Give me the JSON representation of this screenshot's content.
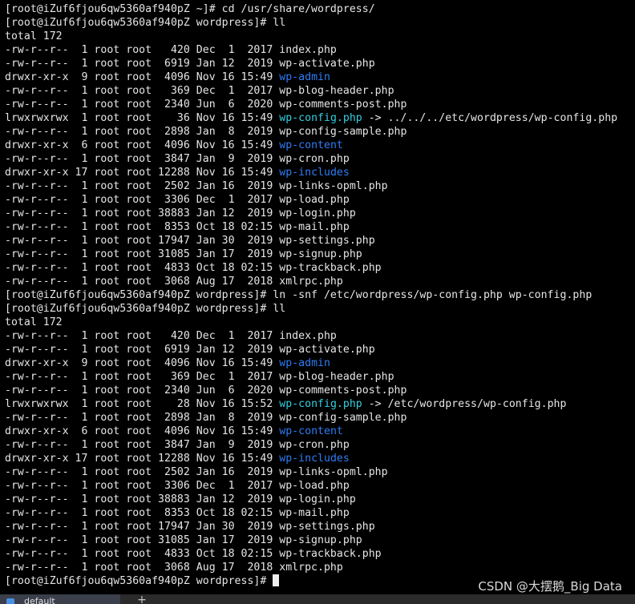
{
  "terminal": {
    "colors": {
      "text": "#e6e6e6",
      "directory": "#2f7df6",
      "symlink": "#33d0e0",
      "background": "#000000"
    },
    "lines": [
      [
        {
          "text": "[root@iZuf6fjou6qw5360af940pZ ~]# cd /usr/share/wordpress/"
        }
      ],
      [
        {
          "text": "[root@iZuf6fjou6qw5360af940pZ wordpress]# ll"
        }
      ],
      [
        {
          "text": "total 172"
        }
      ],
      [
        {
          "text": "-rw-r--r--  1 root root   420 Dec  1  2017 index.php"
        }
      ],
      [
        {
          "text": "-rw-r--r--  1 root root  6919 Jan 12  2019 wp-activate.php"
        }
      ],
      [
        {
          "text": "drwxr-xr-x  9 root root  4096 Nov 16 15:49 "
        },
        {
          "text": "wp-admin",
          "kind": "dir"
        }
      ],
      [
        {
          "text": "-rw-r--r--  1 root root   369 Dec  1  2017 wp-blog-header.php"
        }
      ],
      [
        {
          "text": "-rw-r--r--  1 root root  2340 Jun  6  2020 wp-comments-post.php"
        }
      ],
      [
        {
          "text": "lrwxrwxrwx  1 root root    36 Nov 16 15:49 "
        },
        {
          "text": "wp-config.php",
          "kind": "link"
        },
        {
          "text": " -> ../../../etc/wordpress/wp-config.php"
        }
      ],
      [
        {
          "text": "-rw-r--r--  1 root root  2898 Jan  8  2019 wp-config-sample.php"
        }
      ],
      [
        {
          "text": "drwxr-xr-x  6 root root  4096 Nov 16 15:49 "
        },
        {
          "text": "wp-content",
          "kind": "dir"
        }
      ],
      [
        {
          "text": "-rw-r--r--  1 root root  3847 Jan  9  2019 wp-cron.php"
        }
      ],
      [
        {
          "text": "drwxr-xr-x 17 root root 12288 Nov 16 15:49 "
        },
        {
          "text": "wp-includes",
          "kind": "dir"
        }
      ],
      [
        {
          "text": "-rw-r--r--  1 root root  2502 Jan 16  2019 wp-links-opml.php"
        }
      ],
      [
        {
          "text": "-rw-r--r--  1 root root  3306 Dec  1  2017 wp-load.php"
        }
      ],
      [
        {
          "text": "-rw-r--r--  1 root root 38883 Jan 12  2019 wp-login.php"
        }
      ],
      [
        {
          "text": "-rw-r--r--  1 root root  8353 Oct 18 02:15 wp-mail.php"
        }
      ],
      [
        {
          "text": "-rw-r--r--  1 root root 17947 Jan 30  2019 wp-settings.php"
        }
      ],
      [
        {
          "text": "-rw-r--r--  1 root root 31085 Jan 17  2019 wp-signup.php"
        }
      ],
      [
        {
          "text": "-rw-r--r--  1 root root  4833 Oct 18 02:15 wp-trackback.php"
        }
      ],
      [
        {
          "text": "-rw-r--r--  1 root root  3068 Aug 17  2018 xmlrpc.php"
        }
      ],
      [
        {
          "text": "[root@iZuf6fjou6qw5360af940pZ wordpress]# ln -snf /etc/wordpress/wp-config.php wp-config.php"
        }
      ],
      [
        {
          "text": "[root@iZuf6fjou6qw5360af940pZ wordpress]# ll"
        }
      ],
      [
        {
          "text": "total 172"
        }
      ],
      [
        {
          "text": "-rw-r--r--  1 root root   420 Dec  1  2017 index.php"
        }
      ],
      [
        {
          "text": "-rw-r--r--  1 root root  6919 Jan 12  2019 wp-activate.php"
        }
      ],
      [
        {
          "text": "drwxr-xr-x  9 root root  4096 Nov 16 15:49 "
        },
        {
          "text": "wp-admin",
          "kind": "dir"
        }
      ],
      [
        {
          "text": "-rw-r--r--  1 root root   369 Dec  1  2017 wp-blog-header.php"
        }
      ],
      [
        {
          "text": "-rw-r--r--  1 root root  2340 Jun  6  2020 wp-comments-post.php"
        }
      ],
      [
        {
          "text": "lrwxrwxrwx  1 root root    28 Nov 16 15:52 "
        },
        {
          "text": "wp-config.php",
          "kind": "link"
        },
        {
          "text": " -> /etc/wordpress/wp-config.php"
        }
      ],
      [
        {
          "text": "-rw-r--r--  1 root root  2898 Jan  8  2019 wp-config-sample.php"
        }
      ],
      [
        {
          "text": "drwxr-xr-x  6 root root  4096 Nov 16 15:49 "
        },
        {
          "text": "wp-content",
          "kind": "dir"
        }
      ],
      [
        {
          "text": "-rw-r--r--  1 root root  3847 Jan  9  2019 wp-cron.php"
        }
      ],
      [
        {
          "text": "drwxr-xr-x 17 root root 12288 Nov 16 15:49 "
        },
        {
          "text": "wp-includes",
          "kind": "dir"
        }
      ],
      [
        {
          "text": "-rw-r--r--  1 root root  2502 Jan 16  2019 wp-links-opml.php"
        }
      ],
      [
        {
          "text": "-rw-r--r--  1 root root  3306 Dec  1  2017 wp-load.php"
        }
      ],
      [
        {
          "text": "-rw-r--r--  1 root root 38883 Jan 12  2019 wp-login.php"
        }
      ],
      [
        {
          "text": "-rw-r--r--  1 root root  8353 Oct 18 02:15 wp-mail.php"
        }
      ],
      [
        {
          "text": "-rw-r--r--  1 root root 17947 Jan 30  2019 wp-settings.php"
        }
      ],
      [
        {
          "text": "-rw-r--r--  1 root root 31085 Jan 17  2019 wp-signup.php"
        }
      ],
      [
        {
          "text": "-rw-r--r--  1 root root  4833 Oct 18 02:15 wp-trackback.php"
        }
      ],
      [
        {
          "text": "-rw-r--r--  1 root root  3068 Aug 17  2018 xmlrpc.php"
        }
      ]
    ],
    "prompt": "[root@iZuf6fjou6qw5360af940pZ wordpress]# "
  },
  "tabbar": {
    "tab_label": "default",
    "tab_icon": "terminal-icon",
    "new_tab_label": "+"
  },
  "watermark": "CSDN @大摆鹅_Big Data"
}
